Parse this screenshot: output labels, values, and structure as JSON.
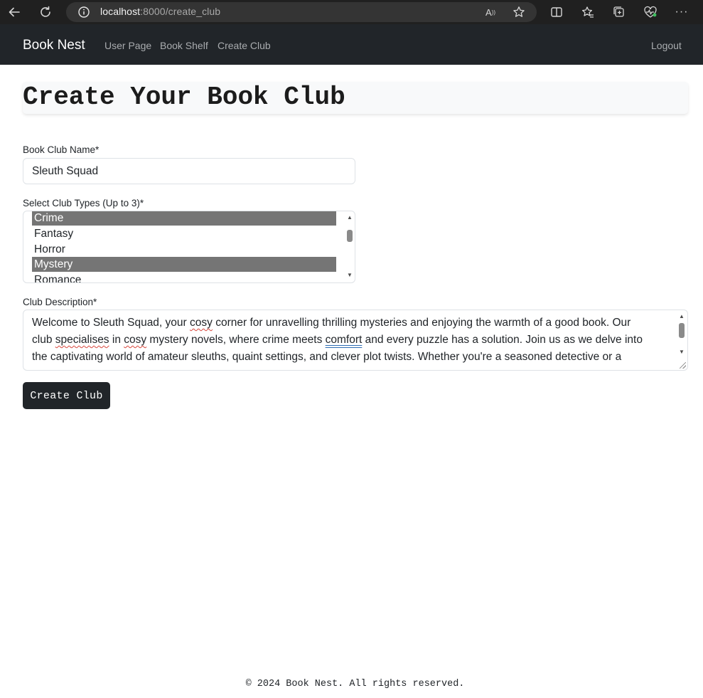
{
  "browser": {
    "url_host": "localhost",
    "url_path": ":8000/create_club",
    "icons": [
      "back-icon",
      "refresh-icon",
      "info-icon",
      "read-aloud-icon",
      "favorite-star-icon",
      "split-screen-icon",
      "favorites-icon",
      "collections-icon",
      "browser-essentials-icon",
      "more-icon"
    ]
  },
  "nav": {
    "brand": "Book Nest",
    "links": [
      "User Page",
      "Book Shelf",
      "Create Club"
    ],
    "logout": "Logout"
  },
  "page": {
    "title": "Create Your Book Club"
  },
  "form": {
    "name_label": "Book Club Name*",
    "name_value": "Sleuth Squad",
    "types_label": "Select Club Types (Up to 3)*",
    "type_options": [
      {
        "label": "Crime",
        "selected": true
      },
      {
        "label": "Fantasy",
        "selected": false
      },
      {
        "label": "Horror",
        "selected": false
      },
      {
        "label": "Mystery",
        "selected": true
      },
      {
        "label": "Romance",
        "selected": false
      }
    ],
    "description_label": "Club Description*",
    "description_lines": [
      "Welcome to Sleuth Squad, your cosy corner for unravelling thrilling mysteries and enjoying the warmth of a good book. Our",
      "club specialises in cosy mystery novels, where crime meets comfort and every puzzle has a solution. Join us as we delve into",
      "the captivating world of amateur sleuths, quaint settings, and clever plot twists. Whether you're a seasoned detective or a"
    ],
    "description_segments": {
      "l1a": "Welcome to Sleuth Squad, your ",
      "l1b": "cosy",
      "l1c": " corner for unravelling thrilling mysteries and enjoying the warmth of a good book. Our",
      "l2a": "club ",
      "l2b": "specialises",
      "l2c": " in ",
      "l2d": "cosy",
      "l2e": " mystery novels, where crime meets ",
      "l2f": "comfort",
      "l2g": " and every puzzle has a solution. Join us as we delve into",
      "l3": "the captivating world of amateur sleuths, quaint settings, and clever plot twists. Whether you're a seasoned detective or a"
    },
    "submit_label": "Create Club"
  },
  "footer": {
    "text": "© 2024 Book Nest. All rights reserved."
  }
}
